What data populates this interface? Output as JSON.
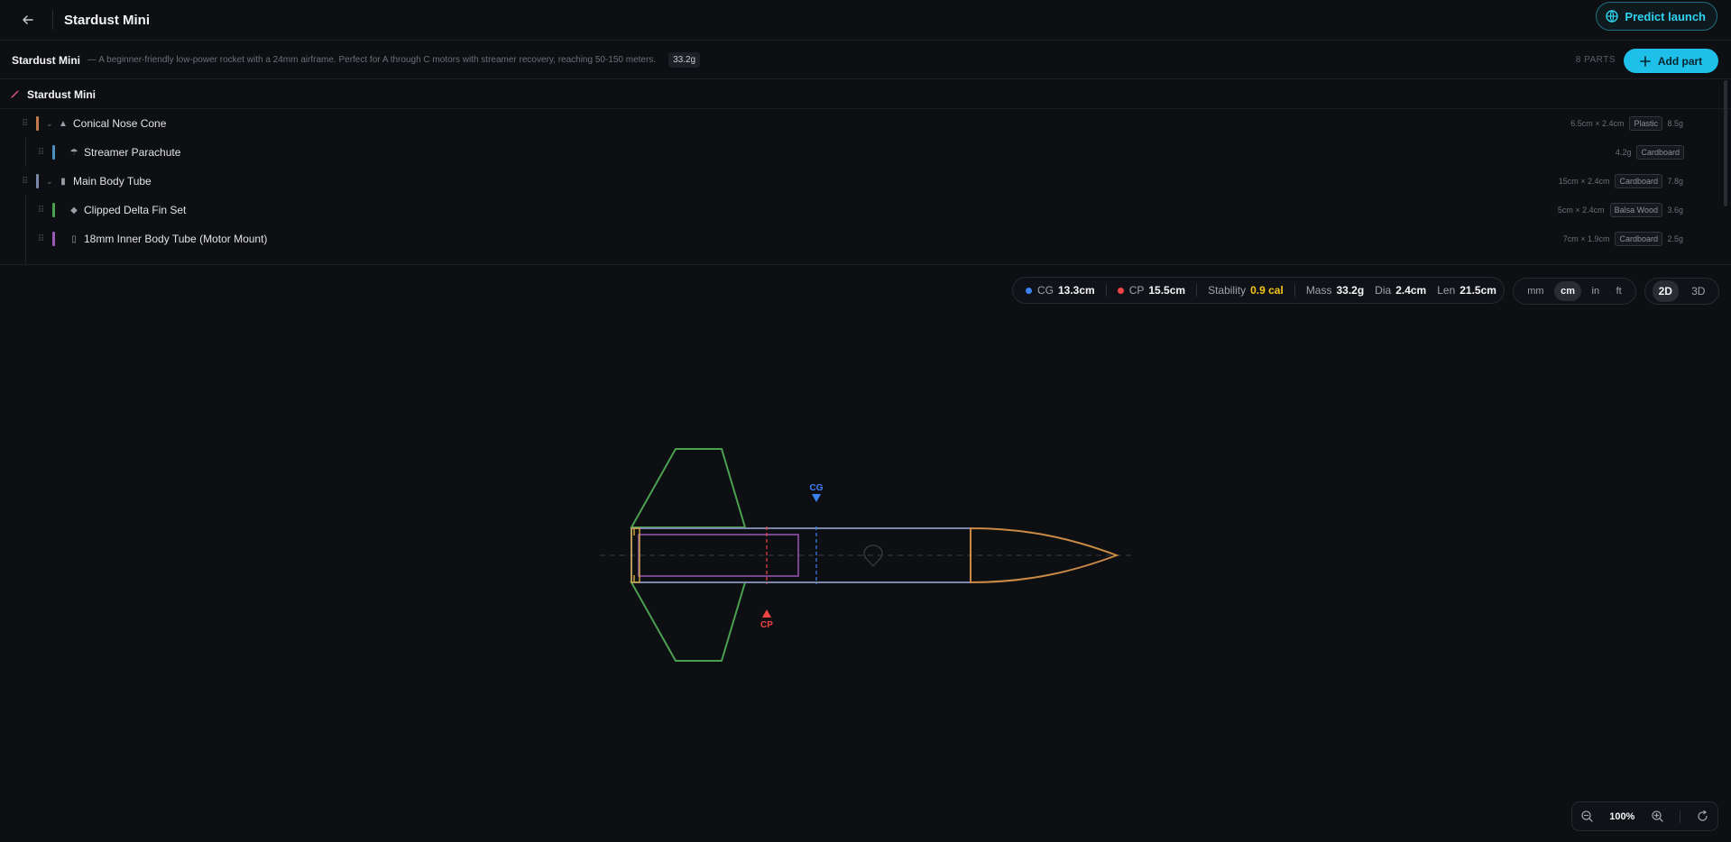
{
  "header": {
    "title": "Stardust Mini",
    "predict_label": "Predict launch"
  },
  "info": {
    "name": "Stardust Mini",
    "description": "— A beginner-friendly low-power rocket with a 24mm airframe. Perfect for A through C motors with streamer recovery, reaching 50-150 meters.",
    "mass": "33.2g",
    "parts_count": "8 PARTS",
    "add_part_label": "Add part"
  },
  "tree": {
    "root": "Stardust Mini",
    "rows": [
      {
        "name": "Conical Nose Cone",
        "dims": "6.5cm × 2.4cm",
        "material": "Plastic",
        "mass": "8.5g",
        "color": "#c07a4a"
      },
      {
        "name": "Streamer Parachute",
        "dims": "",
        "mass_inline": "4.2g",
        "material": "Cardboard",
        "mass": "",
        "color": "#4a8fc0"
      },
      {
        "name": "Main Body Tube",
        "dims": "15cm × 2.4cm",
        "material": "Cardboard",
        "mass": "7.8g",
        "color": "#7a87a8"
      },
      {
        "name": "Clipped Delta Fin Set",
        "dims": "5cm × 2.4cm",
        "material": "Balsa Wood",
        "mass": "3.6g",
        "color": "#4aa050"
      },
      {
        "name": "18mm Inner Body Tube (Motor Mount)",
        "dims": "7cm × 1.9cm",
        "material": "Cardboard",
        "mass": "2.5g",
        "color": "#9a5ab8"
      }
    ]
  },
  "stats": {
    "cg_label": "CG",
    "cg": "13.3cm",
    "cp_label": "CP",
    "cp": "15.5cm",
    "stability_label": "Stability",
    "stability": "0.9 cal",
    "mass_label": "Mass",
    "mass": "33.2g",
    "dia_label": "Dia",
    "dia": "2.4cm",
    "len_label": "Len",
    "len": "21.5cm"
  },
  "units": [
    "mm",
    "cm",
    "in",
    "ft"
  ],
  "views": [
    "2D",
    "3D"
  ],
  "canvas": {
    "cg_marker": "CG",
    "cp_marker": "CP"
  },
  "zoom": {
    "value": "100%"
  },
  "colors": {
    "accent": "#1ec0ea",
    "cg": "#3b82f6",
    "cp": "#ef4444",
    "stability": "#f5c518"
  }
}
